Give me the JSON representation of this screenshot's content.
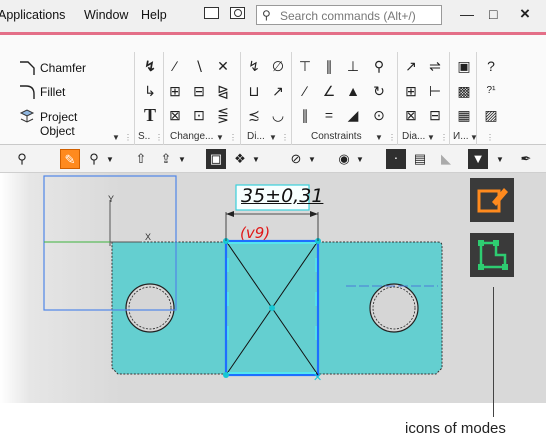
{
  "menu": {
    "items": [
      "Applications",
      "Window",
      "Help"
    ],
    "search_placeholder": "Search commands (Alt+/)",
    "window_controls": [
      "—",
      "□",
      "×"
    ]
  },
  "ribbon": {
    "commands": [
      {
        "label": "Chamfer",
        "icon": "chamfer-icon"
      },
      {
        "label": "Fillet",
        "icon": "fillet-icon"
      },
      {
        "label": "Project Object",
        "icon": "project-object-icon"
      }
    ],
    "groups": [
      "S..",
      "Change...",
      "Di...",
      "Constraints",
      "Dia...",
      "И..."
    ]
  },
  "drawing": {
    "dimension_text": "35±0,31",
    "constraint_text": "(v9)",
    "axis_y": "Y",
    "axis_x": "X"
  },
  "colors": {
    "accent": "#e46f88",
    "part_fill": "#64cfd0",
    "selection": "#1e7bff",
    "mode_orange": "#ff8a1e",
    "mode_green": "#2ecc71"
  },
  "modes": [
    {
      "name": "sketch-edit-mode-icon"
    },
    {
      "name": "contour-mode-icon"
    }
  ],
  "caption": "icons of modes"
}
